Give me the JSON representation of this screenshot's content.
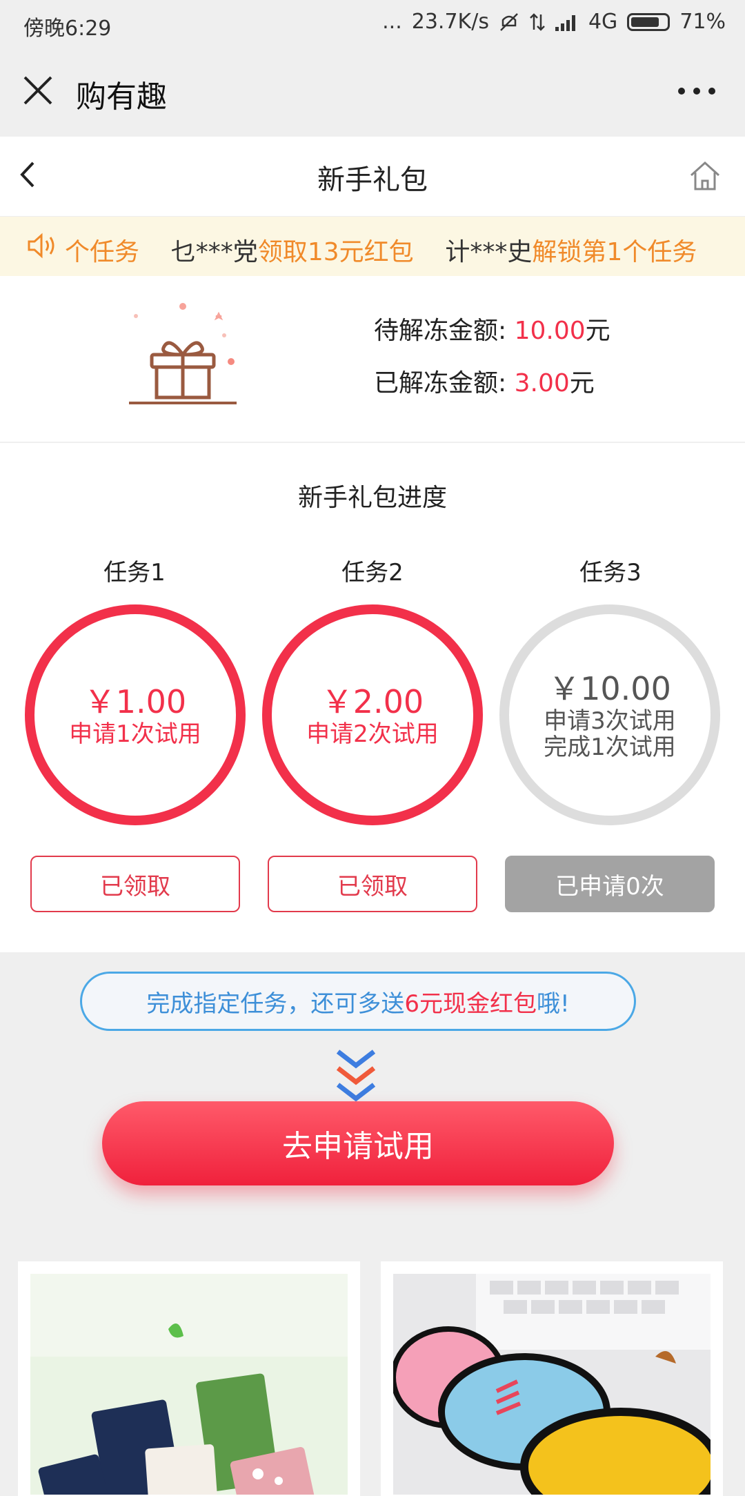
{
  "status_bar": {
    "time": "傍晚6:29",
    "dots": "...",
    "speed": "23.7K/s",
    "network": "4G",
    "battery": "71%",
    "battery_level": 0.71
  },
  "wechat_bar": {
    "title": "购有趣",
    "icons": [
      "close-icon",
      "more-icon"
    ]
  },
  "page_header": {
    "title": "新手礼包",
    "icons": [
      "back-icon",
      "home-icon"
    ]
  },
  "marquee": {
    "seg1": "个任务",
    "seg2_user": "乜***党",
    "seg2_action": "领取13元红包",
    "seg3_user": "计***史",
    "seg3_action": "解锁第1个任务"
  },
  "amounts": {
    "pending_label": "待解冻金额:",
    "pending_value": "10.00",
    "pending_unit": "元",
    "unlocked_label": "已解冻金额:",
    "unlocked_value": "3.00",
    "unlocked_unit": "元"
  },
  "progress": {
    "title": "新手礼包进度",
    "tasks": [
      {
        "label": "任务1",
        "amount": "￥1.00",
        "desc1": "申请1次试用",
        "desc2": "",
        "button": "已领取",
        "done": true
      },
      {
        "label": "任务2",
        "amount": "￥2.00",
        "desc1": "申请2次试用",
        "desc2": "",
        "button": "已领取",
        "done": true
      },
      {
        "label": "任务3",
        "amount": "￥10.00",
        "desc1": "申请3次试用",
        "desc2": "完成1次试用",
        "button": "已申请0次",
        "done": false
      }
    ]
  },
  "bonus": {
    "prefix": "完成指定任务，还可多送",
    "highlight": "6元现金红包",
    "suffix": "哦!"
  },
  "cta": {
    "label": "去申请试用"
  },
  "colors": {
    "accent_red": "#f2304a",
    "orange": "#f08a2a",
    "blue": "#3d8fd8",
    "grey_button": "#a3a3a3"
  }
}
